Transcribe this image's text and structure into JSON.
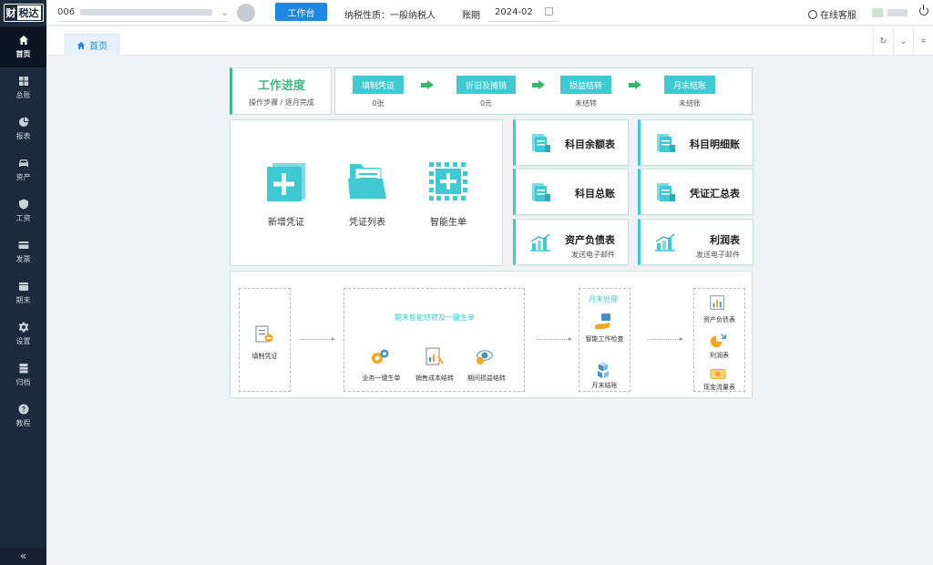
{
  "app": {
    "logo_text_a": "财",
    "logo_text_b": "税达"
  },
  "sidebar": {
    "items": [
      {
        "label": "首页",
        "icon": "home-icon",
        "active": true
      },
      {
        "label": "总账",
        "icon": "grid-icon"
      },
      {
        "label": "报表",
        "icon": "pie-chart-icon"
      },
      {
        "label": "资产",
        "icon": "car-icon"
      },
      {
        "label": "工资",
        "icon": "shield-icon"
      },
      {
        "label": "发票",
        "icon": "card-icon"
      },
      {
        "label": "期末",
        "icon": "calendar-icon"
      },
      {
        "label": "设置",
        "icon": "gear-icon"
      },
      {
        "label": "归档",
        "icon": "archive-icon"
      },
      {
        "label": "教程",
        "icon": "help-icon"
      }
    ],
    "collapse_label": "«"
  },
  "header": {
    "company_code": "006",
    "workbench_label": "工作台",
    "tax_nature": "纳税性质：一般纳税人",
    "period_label": "账期",
    "period_value": "2024-02",
    "support_label": "在线客服"
  },
  "tabs": {
    "home_label": "首页"
  },
  "progress": {
    "title": "工作进度",
    "subtitle": "操作步骤 / 逐月完成",
    "steps": [
      {
        "label": "填制凭证",
        "value": "0张"
      },
      {
        "label": "折旧及摊销",
        "value": "0元"
      },
      {
        "label": "损益结转",
        "value": "未结转"
      },
      {
        "label": "月末结账",
        "value": "未结账"
      }
    ]
  },
  "quick_actions": [
    {
      "label": "新增凭证",
      "icon": "add-voucher-icon"
    },
    {
      "label": "凭证列表",
      "icon": "folder-icon"
    },
    {
      "label": "智能生单",
      "icon": "smart-generate-icon"
    }
  ],
  "reports": [
    {
      "name": "科目余额表",
      "sub": ""
    },
    {
      "name": "科目明细账",
      "sub": ""
    },
    {
      "name": "科目总账",
      "sub": ""
    },
    {
      "name": "凭证汇总表",
      "sub": ""
    },
    {
      "name": "资产负债表",
      "sub": "发送电子邮件"
    },
    {
      "name": "利润表",
      "sub": "发送电子邮件"
    }
  ],
  "flow": {
    "fill_voucher": "填制凭证",
    "smart_title": "期末智能结转及一键生单",
    "business_one_click": "业务一键生单",
    "sales_cost": "销售成本结转",
    "period_profit_loss": "期间损益结转",
    "month_end_title": "月末处理",
    "smart_check": "智能工作检查",
    "month_close": "月末结账",
    "balance_sheet": "资产负债表",
    "income_statement": "利润表",
    "cash_flow": "现金流量表"
  },
  "colors": {
    "sidebar_bg": "#1b2a3d",
    "primary": "#1e88e5",
    "teal": "#3fcad3",
    "green": "#41b883"
  }
}
